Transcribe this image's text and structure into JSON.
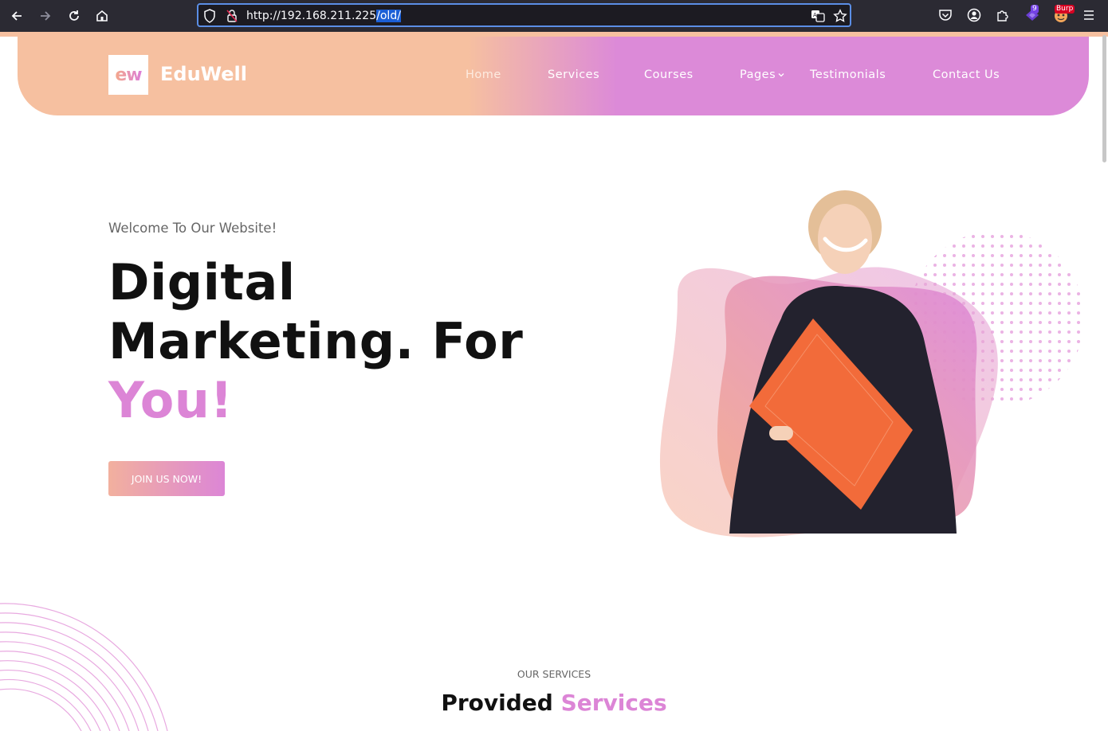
{
  "browser": {
    "url_base": "http://192.168.211.225",
    "url_selected": "/old/",
    "extension_badge_1": "9",
    "extension_badge_2": "Burp"
  },
  "site": {
    "logo_mark": "ew",
    "logo_text": "EduWell",
    "menu": {
      "home": "Home",
      "services": "Services",
      "courses": "Courses",
      "pages": "Pages",
      "testimonials": "Testimonials",
      "contact": "Contact Us"
    }
  },
  "hero": {
    "welcome": "Welcome To Our Website!",
    "line1": "Digital",
    "line2": "Marketing. For",
    "line3": "You!",
    "cta": "JOIN US NOW!"
  },
  "services": {
    "kicker": "OUR SERVICES",
    "title_plain": "Provided",
    "title_accent": "Services"
  },
  "colors": {
    "peach": "#f6c0a0",
    "pink": "#dc8ad8",
    "chrome": "#2b2a33"
  }
}
